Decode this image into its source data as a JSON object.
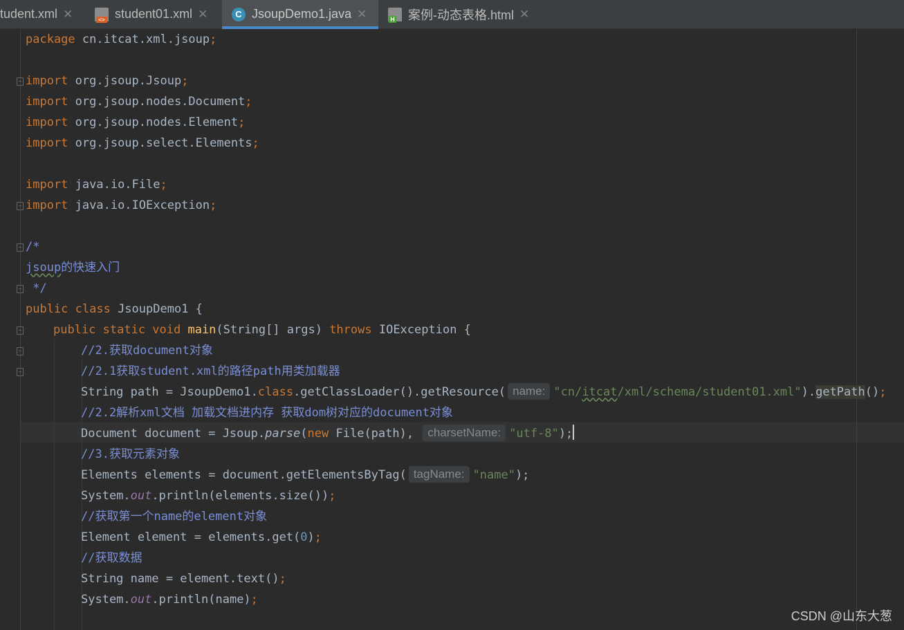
{
  "tabs": [
    {
      "label": "tudent.xml",
      "icon": "xml-file-icon"
    },
    {
      "label": "student01.xml",
      "icon": "xml-file-icon"
    },
    {
      "label": "JsoupDemo1.java",
      "icon": "java-class-icon",
      "active": true
    },
    {
      "label": "案例-动态表格.html",
      "icon": "html-file-icon"
    }
  ],
  "close_glyph": "✕",
  "code": {
    "l1_kw": "package",
    "l1_rest": " cn.itcat.xml.jsoup",
    "semi": ";",
    "import_kw": "import",
    "imp1": " org.jsoup.Jsoup",
    "imp2": " org.jsoup.nodes.Document",
    "imp3": " org.jsoup.nodes.Element",
    "imp4": " org.jsoup.select.Elements",
    "imp5": " java.io.File",
    "imp6": " java.io.IOException",
    "doc_open": "/*",
    "doc_body_a": "jsoup",
    "doc_body_b": "的快速入门",
    "doc_close": " */",
    "cls_kw": "public class",
    "cls_name": " JsoupDemo1",
    "brace_open": " {",
    "main_kw1": "public static void",
    "main_fn": " main",
    "main_params": "(String[] args) ",
    "main_throws": "throws",
    "main_exc": " IOException {",
    "c1": "//2.获取document对象",
    "c2": "//2.1获取student.xml的路径path用类加载器",
    "p_a": "String path = JsoupDemo1.",
    "p_class": "class",
    "p_b": ".getClassLoader().getResource(",
    "hint_name": "name:",
    "p_str_a": "\"cn/",
    "p_str_b": "itcat",
    "p_str_c": "/xml/schema/student01.xml\"",
    "p_c": ").",
    "p_getpath": "getPath",
    "p_d": "()",
    "c3": "//2.2解析xml文档 加载文档进内存 获取dom树对应的document对象",
    "d_a": "Document document = Jsoup.",
    "d_parse": "parse",
    "d_b": "(",
    "d_new": "new",
    "d_c": " File(path), ",
    "hint_charset": "charsetName:",
    "d_str": "\"utf-8\"",
    "d_d": ");",
    "c4": "//3.获取元素对象",
    "e_a": "Elements elements = document.getElementsByTag(",
    "hint_tag": "tagName:",
    "e_str": "\"name\"",
    "e_b": ");",
    "s1_a": "System.",
    "s_out": "out",
    "s1_b": ".println(elements.size())",
    "c5": "//获取第一个name的element对象",
    "g_a": "Element element = elements.get(",
    "g_num": "0",
    "g_b": ")",
    "c6": "//获取数据",
    "t_a": "String name = element.text()",
    "s2_b": ".println(name)"
  },
  "watermark": "CSDN @山东大葱"
}
